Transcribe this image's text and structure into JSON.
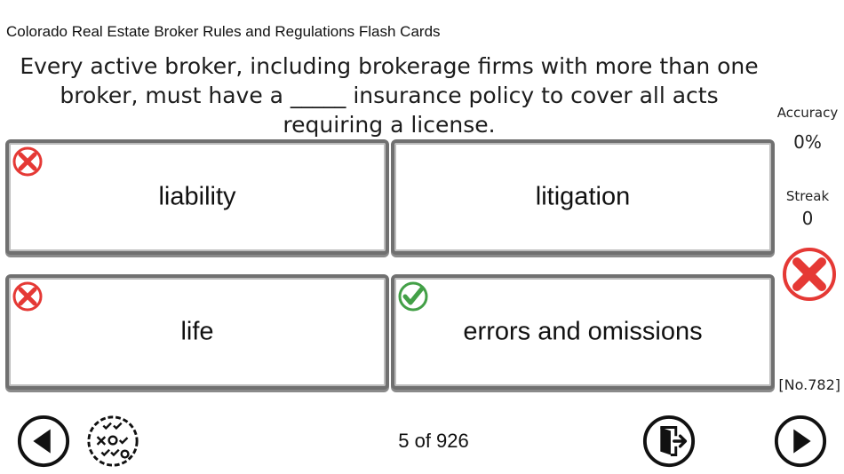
{
  "app": {
    "title": "Colorado Real Estate Broker Rules and Regulations Flash Cards"
  },
  "question": {
    "text": "Every active broker, including brokerage firms with more than one broker, must have a _____ insurance policy to cover all acts requiring a license."
  },
  "answers": [
    {
      "label": "liability",
      "mark": "x-wrong-icon"
    },
    {
      "label": "litigation",
      "mark": ""
    },
    {
      "label": "life",
      "mark": "x-wrong-icon"
    },
    {
      "label": "errors and omissions",
      "mark": "check-correct-icon"
    }
  ],
  "stats": {
    "accuracy_label": "Accuracy",
    "accuracy_value": "0%",
    "streak_label": "Streak",
    "streak_value": "0",
    "result_icon": "big-x-wrong-icon"
  },
  "card_number": "[No.782]",
  "footer": {
    "counter": "5 of 926",
    "buttons": [
      "previous-icon",
      "quiz-mode-icon",
      "exit-icon",
      "next-icon"
    ]
  },
  "colors": {
    "wrong": "#e53935",
    "correct": "#43a047",
    "card_border": "#707070"
  }
}
